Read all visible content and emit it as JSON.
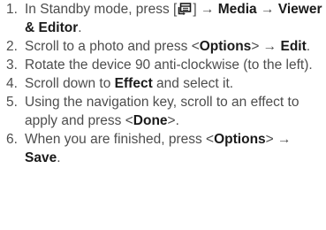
{
  "steps": [
    {
      "number": "1.",
      "parts": {
        "t1": "In Standby mode, press [",
        "t2": "] → ",
        "b1": "Media",
        "t3": " → ",
        "b2": "Viewer & Editor",
        "t4": "."
      },
      "icon": "menu-key-icon"
    },
    {
      "number": "2.",
      "parts": {
        "t1": "Scroll to a photo and press <",
        "b1": "Options",
        "t2": "> → ",
        "b2": "Edit",
        "t3": "."
      }
    },
    {
      "number": "3.",
      "parts": {
        "t1": "Rotate the device 90 anti-clockwise (to the left)."
      }
    },
    {
      "number": "4.",
      "parts": {
        "t1": "Scroll down to ",
        "b1": "Effect",
        "t2": " and select it."
      }
    },
    {
      "number": "5.",
      "parts": {
        "t1": "Using the navigation key, scroll to an effect to apply and press <",
        "b1": "Done",
        "t2": ">."
      }
    },
    {
      "number": "6.",
      "parts": {
        "t1": "When you are finished, press <",
        "b1": "Options",
        "t2": "> → ",
        "b2": "Save",
        "t3": "."
      }
    }
  ]
}
